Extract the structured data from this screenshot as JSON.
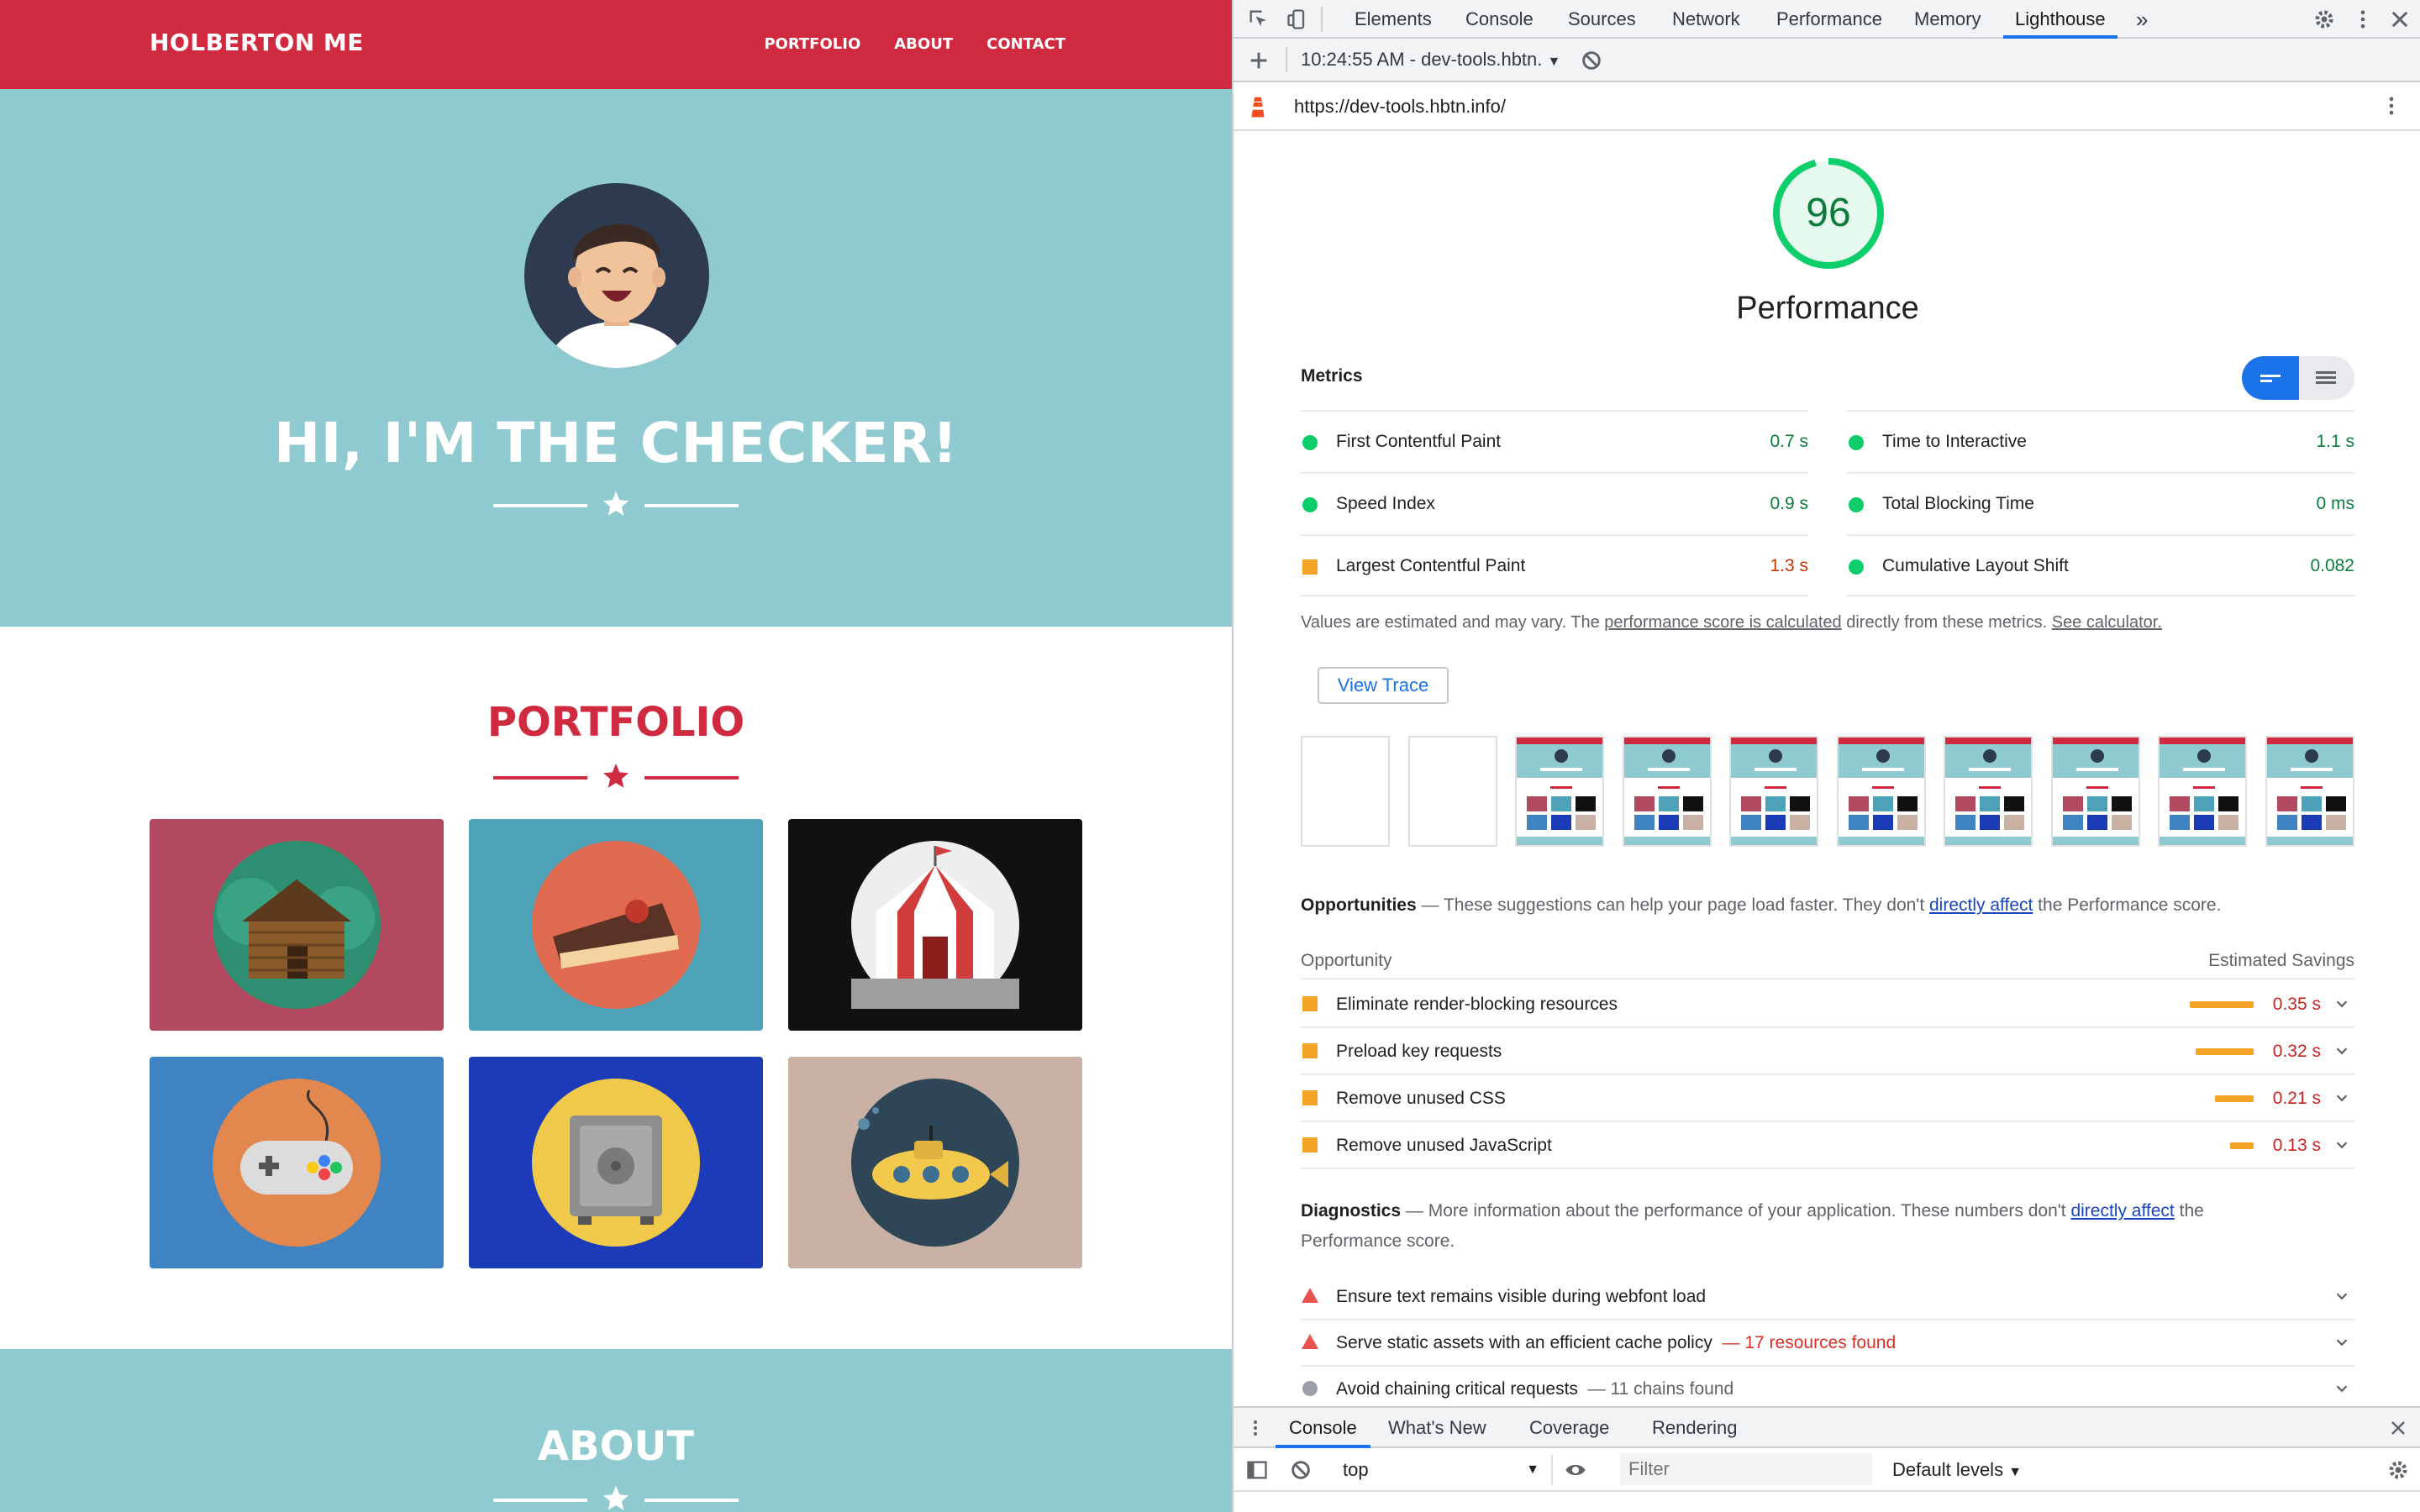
{
  "site": {
    "brand": "HOLBERTON ME",
    "nav": [
      "PORTFOLIO",
      "ABOUT",
      "CONTACT"
    ],
    "hero_title": "HI, I'M THE CHECKER!",
    "portfolio_title": "PORTFOLIO",
    "about_title": "ABOUT",
    "colors": {
      "red": "#d02a41",
      "teal": "#8fcad0"
    },
    "tiles": [
      {
        "name": "cabin-image",
        "bg": "#b2495e",
        "circle": "#2f8f73"
      },
      {
        "name": "cake-image",
        "bg": "#4ea3b8",
        "circle": "#e06a4f"
      },
      {
        "name": "circus-tent-image",
        "bg": "#111111",
        "circle": "#eeeeee"
      },
      {
        "name": "game-controller-image",
        "bg": "#3f83c2",
        "circle": "#e2874d"
      },
      {
        "name": "safe-image",
        "bg": "#1b3bb8",
        "circle": "#f0c84a"
      },
      {
        "name": "submarine-image",
        "bg": "#c9b2a5",
        "circle": "#2f4656"
      }
    ]
  },
  "devtools": {
    "tabs": [
      "Elements",
      "Console",
      "Sources",
      "Network",
      "Performance",
      "Memory",
      "Lighthouse"
    ],
    "active_tab": "Lighthouse",
    "more_tabs": "»",
    "report_time": "10:24:55 AM - dev-tools.hbtn.",
    "url": "https://dev-tools.hbtn.info/",
    "score": "96",
    "category": "Performance",
    "metrics_label": "Metrics",
    "metrics_left": [
      {
        "name": "First Contentful Paint",
        "value": "0.7 s",
        "status": "pass"
      },
      {
        "name": "Speed Index",
        "value": "0.9 s",
        "status": "pass"
      },
      {
        "name": "Largest Contentful Paint",
        "value": "1.3 s",
        "status": "average"
      }
    ],
    "metrics_right": [
      {
        "name": "Time to Interactive",
        "value": "1.1 s",
        "status": "pass"
      },
      {
        "name": "Total Blocking Time",
        "value": "0 ms",
        "status": "pass"
      },
      {
        "name": "Cumulative Layout Shift",
        "value": "0.082",
        "status": "pass"
      }
    ],
    "note": {
      "pre": "Values are estimated and may vary. The ",
      "link1": "performance score is calculated",
      "mid": " directly from these metrics. ",
      "link2": "See calculator."
    },
    "view_trace": "View Trace",
    "filmstrip_frames": 10,
    "opportunities": {
      "title": "Opportunities",
      "dash": "—",
      "desc_pre": "These suggestions can help your page load faster. They don't ",
      "desc_link": "directly affect",
      "desc_post": " the Performance score.",
      "col_left": "Opportunity",
      "col_right": "Estimated Savings",
      "items": [
        {
          "name": "Eliminate render-blocking resources",
          "savings": "0.35 s",
          "bar_fraction": 1.0
        },
        {
          "name": "Preload key requests",
          "savings": "0.32 s",
          "bar_fraction": 0.91
        },
        {
          "name": "Remove unused CSS",
          "savings": "0.21 s",
          "bar_fraction": 0.6
        },
        {
          "name": "Remove unused JavaScript",
          "savings": "0.13 s",
          "bar_fraction": 0.37
        }
      ]
    },
    "diagnostics": {
      "title": "Diagnostics",
      "dash": "—",
      "desc_pre": "More information about the performance of your application. These numbers don't ",
      "desc_link": "directly affect",
      "desc_post": " the",
      "desc_line2": "Performance score.",
      "items": [
        {
          "name": "Ensure text remains visible during webfont load",
          "extra": "",
          "severity": "fail"
        },
        {
          "name": "Serve static assets with an efficient cache policy",
          "extra": "— 17 resources found",
          "severity": "fail"
        },
        {
          "name": "Avoid chaining critical requests",
          "extra": "— 11 chains found",
          "severity": "info"
        }
      ]
    },
    "colors": {
      "pass": "#0cce6b",
      "average": "#f4a324",
      "fail": "#e8534d",
      "accent": "#1a73e8"
    },
    "drawer": {
      "tabs": [
        "Console",
        "What's New",
        "Coverage",
        "Rendering"
      ],
      "active_tab": "Console",
      "context": "top",
      "filter_placeholder": "Filter",
      "levels": "Default levels"
    }
  }
}
